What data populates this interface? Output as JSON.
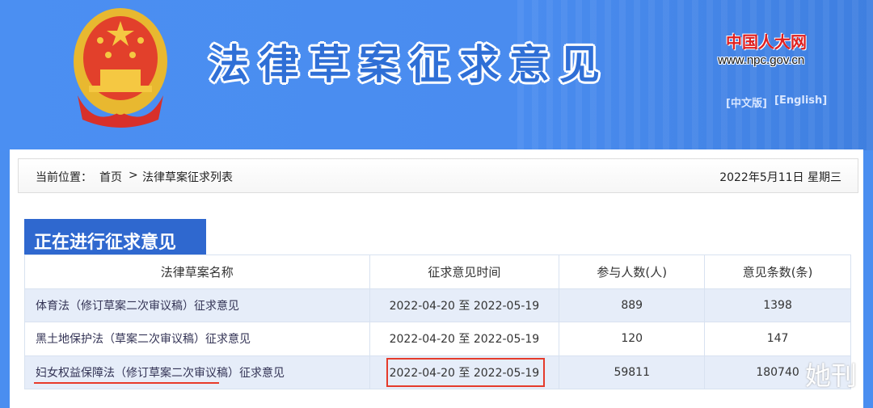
{
  "header": {
    "title": "法律草案征求意见",
    "site_logo": "中国人大网",
    "site_url": "www.npc.gov.cn",
    "lang_cn": "[中文版]",
    "lang_en": "[English]"
  },
  "breadcrumb": {
    "label": "当前位置：",
    "home": "首页",
    "sep": ">",
    "current": "法律草案征求列表",
    "date": "2022年5月11日  星期三"
  },
  "section": {
    "title": "正在进行征求意见"
  },
  "table": {
    "headers": [
      "法律草案名称",
      "征求意见时间",
      "参与人数(人)",
      "意见条数(条)"
    ],
    "rows": [
      {
        "name": "体育法（修订草案二次审议稿）征求意见",
        "period": "2022-04-20 至 2022-05-19",
        "participants": "889",
        "comments": "1398"
      },
      {
        "name": "黑土地保护法（草案二次审议稿）征求意见",
        "period": "2022-04-20 至 2022-05-19",
        "participants": "120",
        "comments": "147"
      },
      {
        "name": "妇女权益保障法（修订草案二次审议稿）征求意见",
        "period": "2022-04-20 至 2022-05-19",
        "participants": "59811",
        "comments": "180740"
      }
    ]
  },
  "watermark": "她刊",
  "colors": {
    "banner": "#4a8ef0",
    "tag": "#2f68cf",
    "highlight": "#e53b2b"
  }
}
